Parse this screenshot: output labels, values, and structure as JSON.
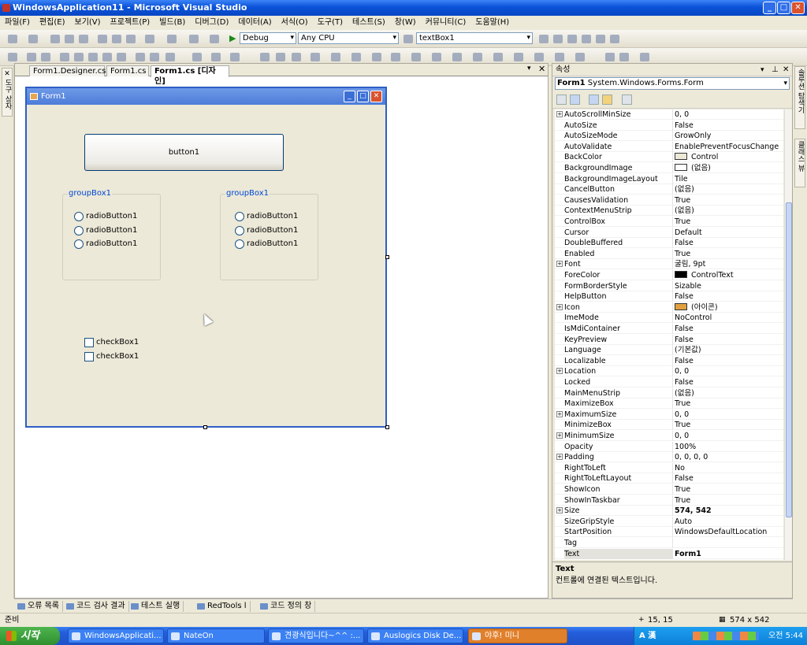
{
  "window": {
    "title": "WindowsApplication11 - Microsoft Visual Studio"
  },
  "menu": [
    "파일(F)",
    "편집(E)",
    "보기(V)",
    "프로젝트(P)",
    "빌드(B)",
    "디버그(D)",
    "데이터(A)",
    "서식(O)",
    "도구(T)",
    "테스트(S)",
    "창(W)",
    "커뮤니티(C)",
    "도움말(H)"
  ],
  "toolbar": {
    "config": "Debug",
    "platform": "Any CPU",
    "find": "textBox1"
  },
  "left_strip": {
    "tab1": "도구 상자"
  },
  "right_strip": {
    "tab1": "솔루션 탐색기",
    "tab2": "클래스 뷰"
  },
  "doc_tabs": [
    {
      "label": "Form1.Designer.cs",
      "active": false
    },
    {
      "label": "Form1.cs",
      "active": false
    },
    {
      "label": "Form1.cs [디자인]",
      "active": true
    }
  ],
  "designer": {
    "form_title": "Form1",
    "button1": "button1",
    "groupbox_left": {
      "title": "groupBox1",
      "radios": [
        "radioButton1",
        "radioButton1",
        "radioButton1"
      ]
    },
    "groupbox_right": {
      "title": "groupBox1",
      "radios": [
        "radioButton1",
        "radioButton1",
        "radioButton1"
      ]
    },
    "checkboxes": [
      "checkBox1",
      "checkBox1"
    ]
  },
  "properties": {
    "header": "속성",
    "object_name": "Form1",
    "object_type": "System.Windows.Forms.Form",
    "rows": [
      {
        "name": "AutoScrollMinSize",
        "value": "0, 0",
        "expand": true
      },
      {
        "name": "AutoSize",
        "value": "False"
      },
      {
        "name": "AutoSizeMode",
        "value": "GrowOnly"
      },
      {
        "name": "AutoValidate",
        "value": "EnablePreventFocusChange"
      },
      {
        "name": "BackColor",
        "value": "Control",
        "swatch": "#ece9d8"
      },
      {
        "name": "BackgroundImage",
        "value": "(없음)",
        "swatch": "#ffffff"
      },
      {
        "name": "BackgroundImageLayout",
        "value": "Tile"
      },
      {
        "name": "CancelButton",
        "value": "(없음)"
      },
      {
        "name": "CausesValidation",
        "value": "True"
      },
      {
        "name": "ContextMenuStrip",
        "value": "(없음)"
      },
      {
        "name": "ControlBox",
        "value": "True"
      },
      {
        "name": "Cursor",
        "value": "Default"
      },
      {
        "name": "DoubleBuffered",
        "value": "False"
      },
      {
        "name": "Enabled",
        "value": "True"
      },
      {
        "name": "Font",
        "value": "굴림, 9pt",
        "expand": true
      },
      {
        "name": "ForeColor",
        "value": "ControlText",
        "swatch": "#000000"
      },
      {
        "name": "FormBorderStyle",
        "value": "Sizable"
      },
      {
        "name": "HelpButton",
        "value": "False"
      },
      {
        "name": "Icon",
        "value": "(아이콘)",
        "expand": true,
        "swatch": "#e0a040"
      },
      {
        "name": "ImeMode",
        "value": "NoControl"
      },
      {
        "name": "IsMdiContainer",
        "value": "False"
      },
      {
        "name": "KeyPreview",
        "value": "False"
      },
      {
        "name": "Language",
        "value": "(기본값)"
      },
      {
        "name": "Localizable",
        "value": "False"
      },
      {
        "name": "Location",
        "value": "0, 0",
        "expand": true
      },
      {
        "name": "Locked",
        "value": "False"
      },
      {
        "name": "MainMenuStrip",
        "value": "(없음)"
      },
      {
        "name": "MaximizeBox",
        "value": "True"
      },
      {
        "name": "MaximumSize",
        "value": "0, 0",
        "expand": true
      },
      {
        "name": "MinimizeBox",
        "value": "True"
      },
      {
        "name": "MinimumSize",
        "value": "0, 0",
        "expand": true
      },
      {
        "name": "Opacity",
        "value": "100%"
      },
      {
        "name": "Padding",
        "value": "0, 0, 0, 0",
        "expand": true
      },
      {
        "name": "RightToLeft",
        "value": "No"
      },
      {
        "name": "RightToLeftLayout",
        "value": "False"
      },
      {
        "name": "ShowIcon",
        "value": "True"
      },
      {
        "name": "ShowInTaskbar",
        "value": "True"
      },
      {
        "name": "Size",
        "value": "574, 542",
        "expand": true,
        "bold": true
      },
      {
        "name": "SizeGripStyle",
        "value": "Auto"
      },
      {
        "name": "StartPosition",
        "value": "WindowsDefaultLocation"
      },
      {
        "name": "Tag",
        "value": ""
      },
      {
        "name": "Text",
        "value": "Form1",
        "bold": true,
        "selected": true
      }
    ],
    "desc_title": "Text",
    "desc_text": "컨트롤에 연결된 텍스트입니다."
  },
  "bottom_tabs": [
    "오류 목록",
    "코드 검사 결과",
    "테스트 실행",
    "RedTools l",
    "코드 정의 창"
  ],
  "status": {
    "left": "준비",
    "pos": "15, 15",
    "size": "574 x 542"
  },
  "taskbar": {
    "start": "시작",
    "items": [
      {
        "label": "WindowsApplicati...",
        "active": false
      },
      {
        "label": "NateOn",
        "active": false
      },
      {
        "label": "견광식입니다~^^ :...",
        "active": false
      },
      {
        "label": "Auslogics Disk De...",
        "active": false
      },
      {
        "label": "야후! 미니",
        "active": true
      }
    ],
    "ime": "A 漢",
    "clock": "오전 5:44"
  }
}
